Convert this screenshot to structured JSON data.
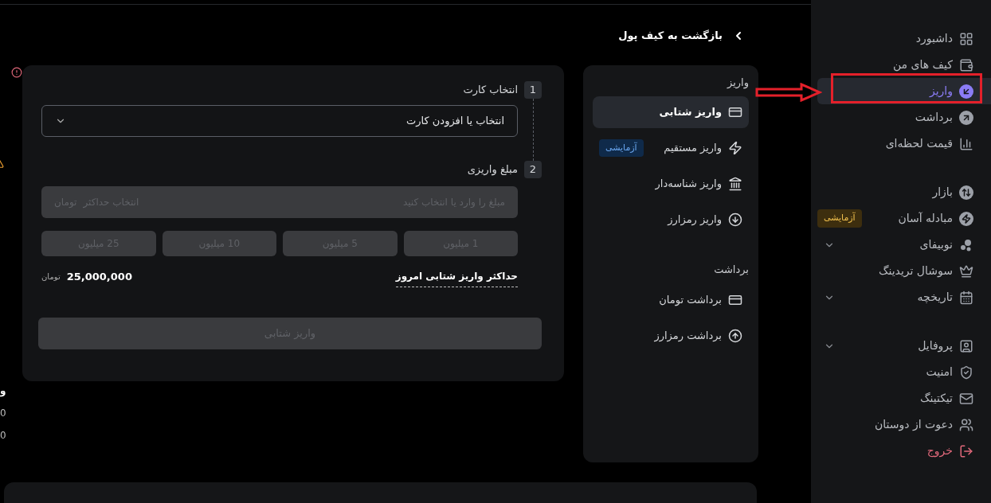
{
  "sidebar": {
    "groups": [
      {
        "items": [
          {
            "label": "داشبورد",
            "selected": false
          },
          {
            "label": "کیف های من",
            "selected": false
          },
          {
            "label": "واریز",
            "selected": true
          },
          {
            "label": "برداشت",
            "selected": false
          },
          {
            "label": "قیمت لحظه‌ای",
            "selected": false
          }
        ]
      },
      {
        "items": [
          {
            "label": "بازار",
            "selected": false
          },
          {
            "label": "مبادله آسان",
            "selected": false,
            "badge": "آزمایشی"
          },
          {
            "label": "نوبیفای",
            "selected": false,
            "has_submenu": true
          },
          {
            "label": "سوشال تریدینگ",
            "selected": false
          },
          {
            "label": "تاریخچه",
            "selected": false,
            "has_submenu": true
          }
        ]
      },
      {
        "items": [
          {
            "label": "پروفایل",
            "selected": false,
            "has_submenu": true
          },
          {
            "label": "امنیت",
            "selected": false
          },
          {
            "label": "تیکتینگ",
            "selected": false
          },
          {
            "label": "دعوت از دوستان",
            "selected": false
          },
          {
            "label": "خروج",
            "selected": false,
            "kind": "logout"
          }
        ]
      }
    ]
  },
  "back_link": "بازگشت به کیف پول",
  "menu": {
    "sections": [
      {
        "title": "واریز",
        "items": [
          {
            "label": "واریز شتابی",
            "selected": true
          },
          {
            "label": "واریز مستقیم",
            "selected": false,
            "badge": "آزمایشی"
          },
          {
            "label": "واریز شناسه‌دار",
            "selected": false
          },
          {
            "label": "واریز رمزارز",
            "selected": false
          }
        ]
      },
      {
        "title": "برداشت",
        "items": [
          {
            "label": "برداشت تومان",
            "selected": false
          },
          {
            "label": "برداشت رمزارز",
            "selected": false
          }
        ]
      }
    ]
  },
  "form": {
    "steps": [
      {
        "number": "1",
        "label": "انتخاب کارت"
      },
      {
        "number": "2",
        "label": "مبلغ واریزی"
      }
    ],
    "card_select": {
      "placeholder": "انتخاب یا افزودن کارت"
    },
    "amount": {
      "placeholder": "مبلغ را وارد یا انتخاب کنید",
      "max_link": "انتخاب حداکثر",
      "unit": "تومان",
      "disabled": true
    },
    "presets": [
      {
        "label": "1 میلیون",
        "disabled": true
      },
      {
        "label": "5 میلیون",
        "disabled": true
      },
      {
        "label": "10 میلیون",
        "disabled": true
      },
      {
        "label": "25 میلیون",
        "disabled": true
      }
    ],
    "limit": {
      "label": "حداکثر واریز شتابی امروز",
      "value": "25,000,000",
      "unit": "تومان"
    },
    "submit": {
      "label": "واریز شتابی",
      "disabled": true
    }
  },
  "left_edge": [
    "و",
    "0",
    "0"
  ]
}
